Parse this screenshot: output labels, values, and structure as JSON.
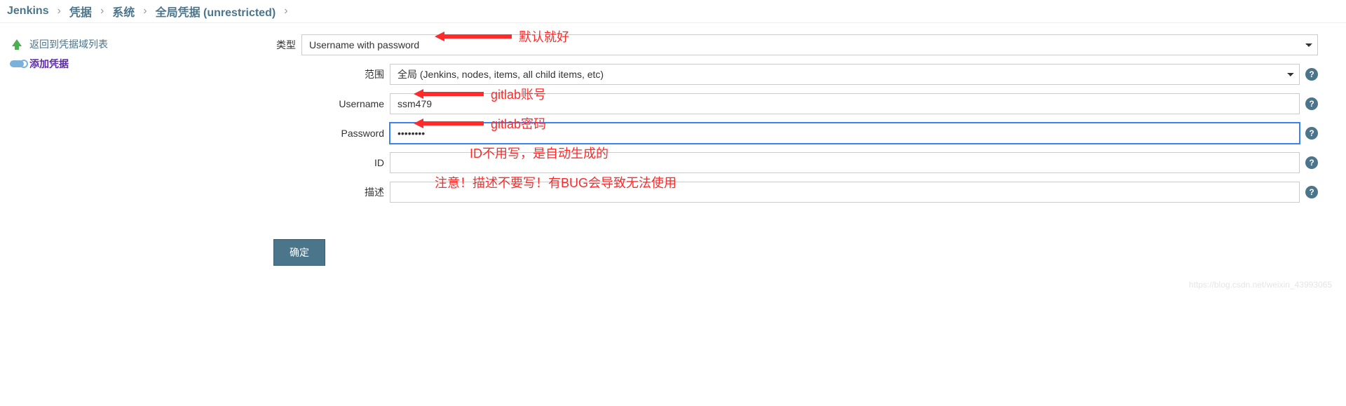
{
  "breadcrumbs": {
    "items": [
      "Jenkins",
      "凭据",
      "系统",
      "全局凭据 (unrestricted)"
    ]
  },
  "sidebar": {
    "back": {
      "label": "返回到凭据域列表"
    },
    "add": {
      "label": "添加凭据"
    }
  },
  "form": {
    "type_label": "类型",
    "type_value": "Username with password",
    "scope_label": "范围",
    "scope_value": "全局 (Jenkins, nodes, items, all child items, etc)",
    "username_label": "Username",
    "username_value": "ssm479",
    "password_label": "Password",
    "password_value": "••••••••",
    "id_label": "ID",
    "id_value": "",
    "desc_label": "描述",
    "desc_value": "",
    "submit_label": "确定"
  },
  "annotations": {
    "a1": "默认就好",
    "a2": "gitlab账号",
    "a3": "gitlab密码",
    "a4": "ID不用写，是自动生成的",
    "a5": "注意！描述不要写！有BUG会导致无法使用"
  },
  "help_glyph": "?",
  "watermark": "https://blog.csdn.net/weixin_43993065"
}
